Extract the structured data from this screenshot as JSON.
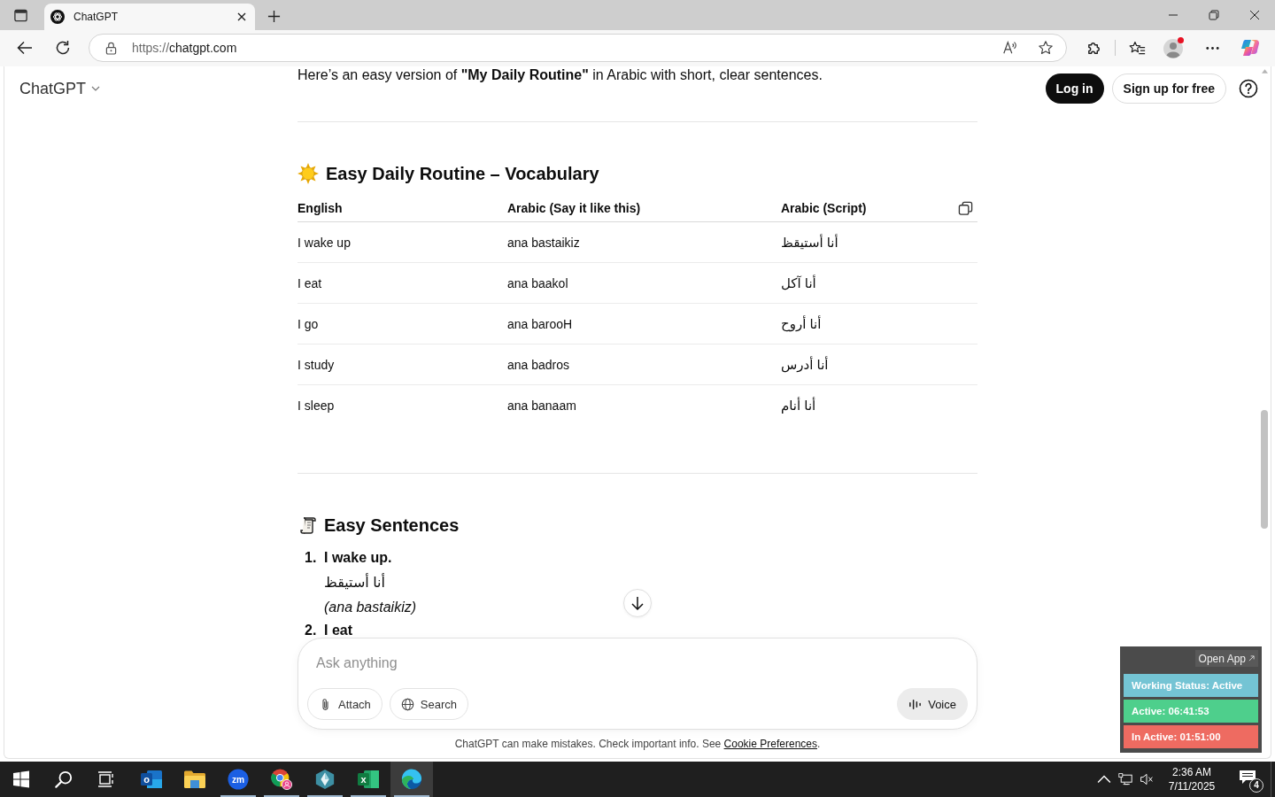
{
  "browser": {
    "tabs": [
      {
        "title": "ChatGPT",
        "selected": true
      }
    ],
    "address": {
      "scheme": "https://",
      "host": "chatgpt.com"
    }
  },
  "page": {
    "model_menu": "ChatGPT",
    "login": "Log in",
    "signup": "Sign up for free",
    "intro": "Here’s an easy version of **\"My Daily Routine\"** in Arabic with short, clear sentences.",
    "vocabulary": {
      "title": "Easy Daily Routine – Vocabulary",
      "columns": [
        "English",
        "Arabic (Say it like this)",
        "Arabic (Script)"
      ],
      "rows": [
        [
          "I wake up",
          "ana bastaikiz",
          "أنا أستيقظ"
        ],
        [
          "I eat",
          "ana baakol",
          "أنا آكل"
        ],
        [
          "I go",
          "ana barooH",
          "أنا أروح"
        ],
        [
          "I study",
          "ana badros",
          "أنا أدرس"
        ],
        [
          "I sleep",
          "ana banaam",
          "أنا أنام"
        ]
      ]
    },
    "sentences": {
      "title": "Easy Sentences",
      "items": [
        {
          "number": "1.",
          "english": "I wake up.",
          "arabic": "أنا أستيقظ",
          "transliteration": "(ana bastaikiz)"
        },
        {
          "number": "2.",
          "english": "I eat"
        }
      ]
    },
    "composer": {
      "placeholder": "Ask anything",
      "buttons": [
        {
          "kind": "attach",
          "label": "Attach"
        },
        {
          "kind": "search",
          "label": "Search"
        }
      ],
      "voice": "Voice"
    },
    "disclaimer": {
      "text": "ChatGPT can make mistakes. Check important info. See",
      "link": "Cookie Preferences",
      "end": "."
    }
  },
  "tracker": {
    "open_app": "Open App",
    "rows": [
      {
        "text": "Working Status: Active",
        "color": "#74c4d4"
      },
      {
        "text": "Active: 06:41:53",
        "color": "#4ecf8c"
      },
      {
        "text": "In Active: 01:51:00",
        "color": "#ee6b61"
      }
    ]
  },
  "taskbar": {
    "apps": [
      {
        "kind": "outlook",
        "glyph": "o",
        "running": false,
        "selected": false
      },
      {
        "kind": "explorer",
        "running": false,
        "selected": false
      },
      {
        "kind": "zoom",
        "glyph": "zm",
        "running": true,
        "selected": false
      },
      {
        "kind": "chrome",
        "running": true,
        "selected": false
      },
      {
        "kind": "diamond",
        "running": true,
        "selected": false
      },
      {
        "kind": "excel",
        "glyph": "x",
        "running": true,
        "selected": false
      },
      {
        "kind": "edge",
        "running": true,
        "selected": true
      }
    ],
    "time": "2:36 AM",
    "date": "7/11/2025",
    "notifications": "4"
  }
}
